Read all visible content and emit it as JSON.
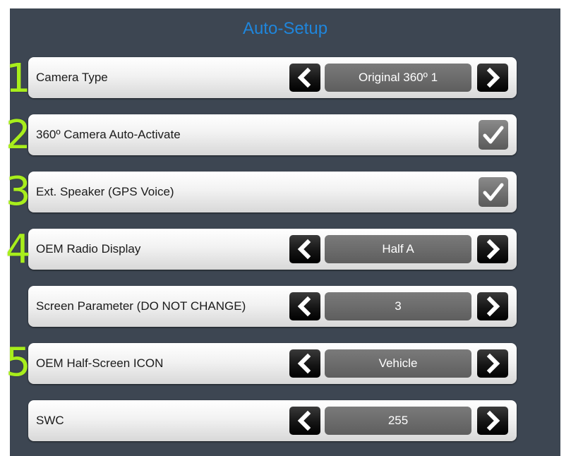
{
  "title": "Auto-Setup",
  "accent_color": "#1f86dc",
  "marker_color": "#a8ee1c",
  "rows": [
    {
      "label": "Camera Type",
      "type": "selector",
      "value": "Original 360º 1",
      "left_icon": "chevron-left-icon",
      "right_icon": "chevron-right-icon"
    },
    {
      "label": "360º Camera Auto-Activate",
      "type": "checkbox",
      "checked": true,
      "icon": "checkmark-icon"
    },
    {
      "label": "Ext. Speaker (GPS Voice)",
      "type": "checkbox",
      "checked": true,
      "icon": "checkmark-icon"
    },
    {
      "label": "OEM Radio Display",
      "type": "selector",
      "value": "Half A",
      "left_icon": "chevron-left-icon",
      "right_icon": "chevron-right-icon"
    },
    {
      "label": "Screen Parameter (DO NOT CHANGE)",
      "type": "selector",
      "value": "3",
      "left_icon": "chevron-left-icon",
      "right_icon": "chevron-right-icon"
    },
    {
      "label": "OEM Half-Screen ICON",
      "type": "selector",
      "value": "Vehicle",
      "left_icon": "chevron-left-icon",
      "right_icon": "chevron-right-icon"
    },
    {
      "label": "SWC",
      "type": "selector",
      "value": "255",
      "left_icon": "chevron-left-icon",
      "right_icon": "chevron-right-icon"
    }
  ],
  "markers": [
    "1",
    "2",
    "3",
    "4",
    "5"
  ]
}
